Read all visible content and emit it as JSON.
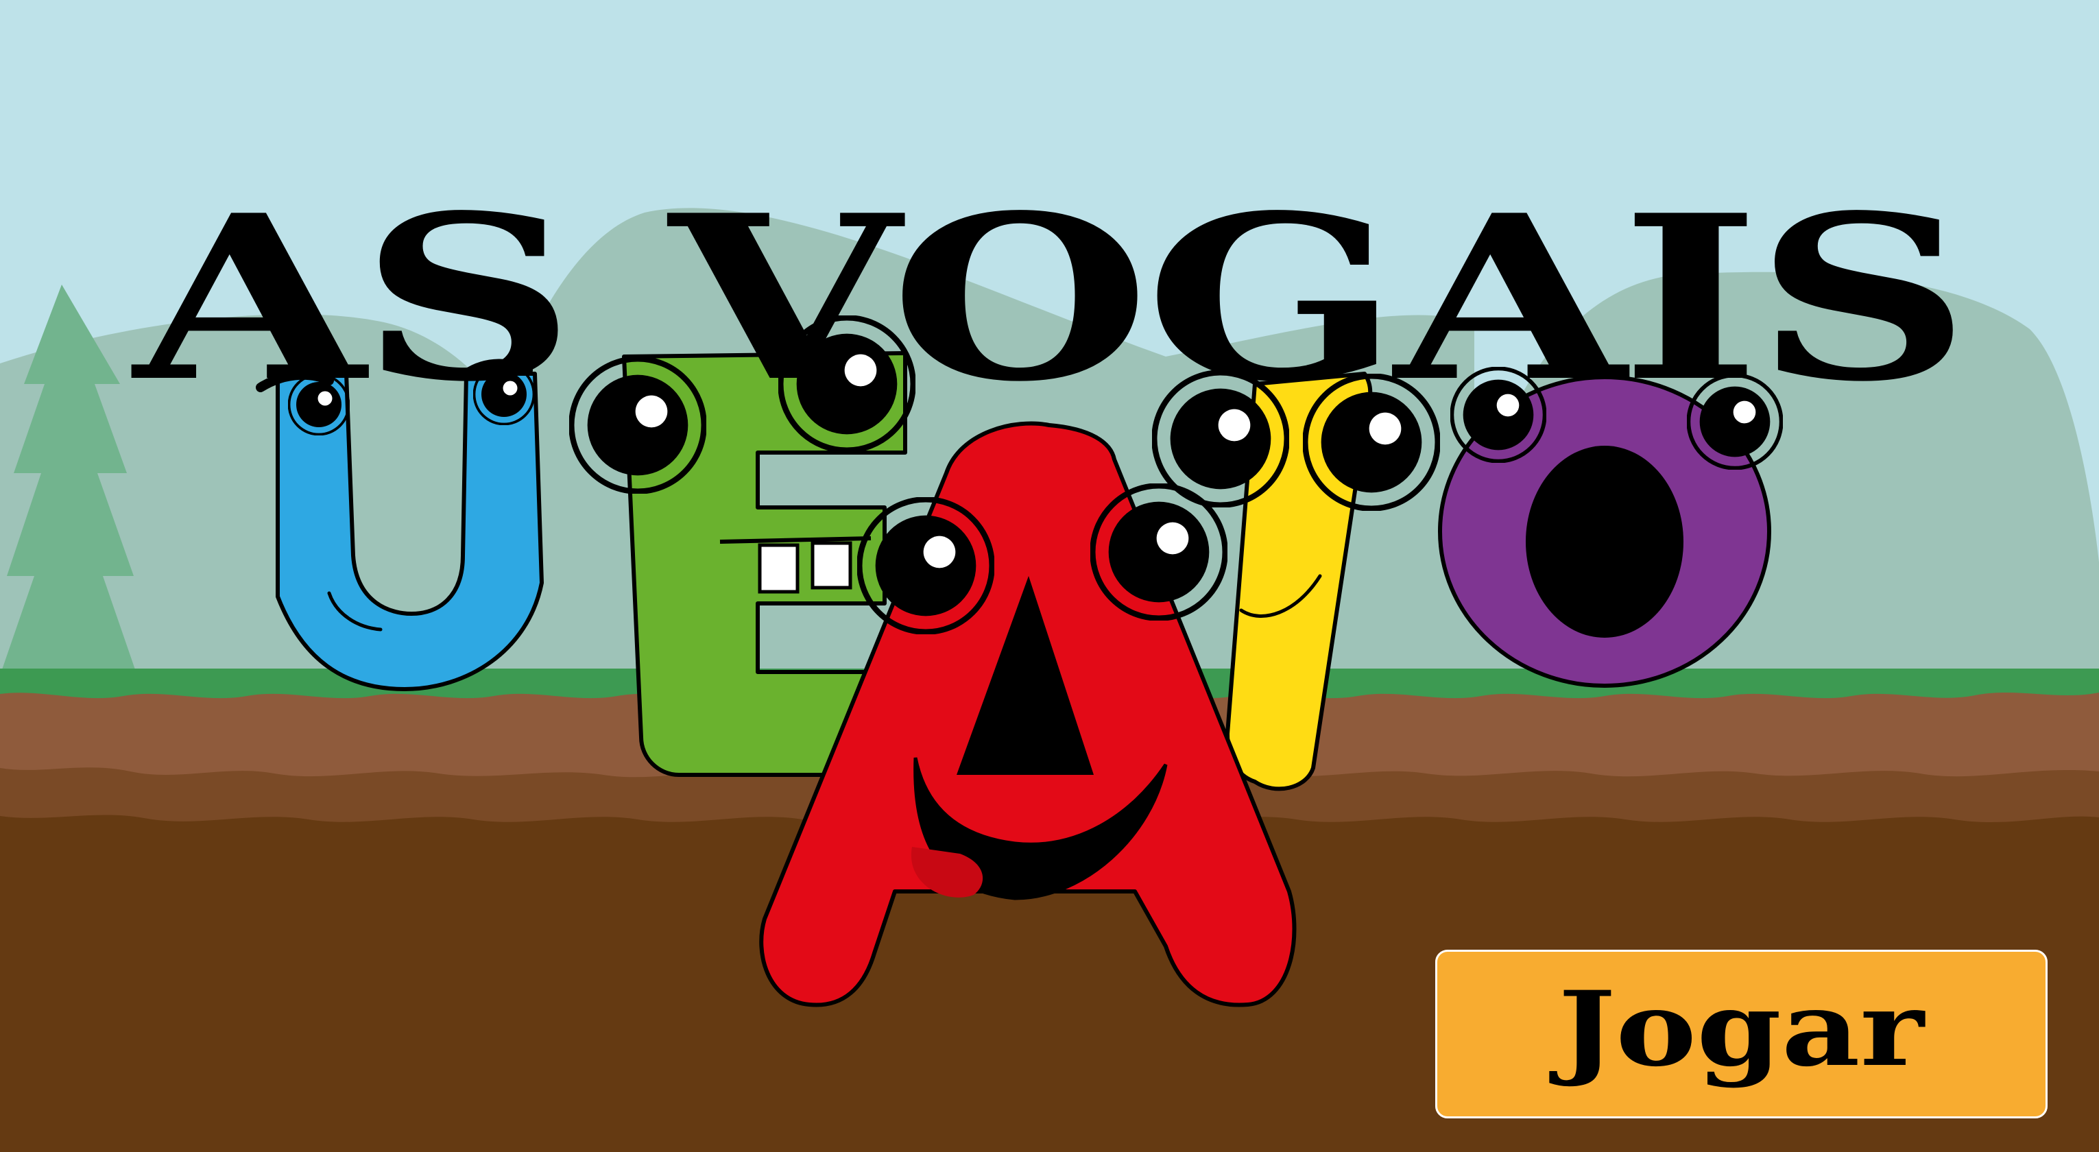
{
  "title": "AS VOGAIS",
  "play_button": {
    "label": "Jogar"
  },
  "characters": [
    {
      "letter": "U",
      "color": "#2ea8e3",
      "icon": "letter-u-character"
    },
    {
      "letter": "E",
      "color": "#6ab22e",
      "icon": "letter-e-character"
    },
    {
      "letter": "I",
      "color": "#ffdc14",
      "icon": "letter-i-character"
    },
    {
      "letter": "O",
      "color": "#7f3592",
      "icon": "letter-o-character"
    },
    {
      "letter": "A",
      "color": "#e30a17",
      "icon": "letter-a-character"
    }
  ],
  "colors": {
    "sky": "#bee2e9",
    "hill": "#9ec3b8",
    "tree": "#72b48e",
    "grass": "#3d9a52",
    "soil_top": "#8f5b3c",
    "soil_mid": "#7a4a26",
    "soil_bottom": "#653a12",
    "button": "#f8ac30",
    "title_text": "#000000",
    "button_text": "#000000"
  }
}
